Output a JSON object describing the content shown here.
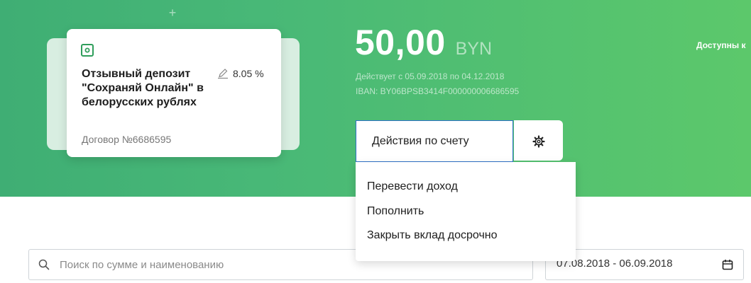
{
  "deposit_card": {
    "title": "Отзывный депозит \"Сохраняй Онлайн\" в белорусских рублях",
    "rate": "8.05 %",
    "contract": "Договор №6686595",
    "icon": "safe-icon"
  },
  "account": {
    "balance": "50,00",
    "currency": "BYN",
    "validity": "Действует с 05.09.2018 по 04.12.2018",
    "iban": "IBAN: BY06BPSB3414F000000006686595",
    "available_label": "Доступны к"
  },
  "actions": {
    "button_label": "Действия по счету",
    "settings_icon": "gear-icon",
    "menu": [
      {
        "label": "Перевести доход"
      },
      {
        "label": "Пополнить"
      },
      {
        "label": "Закрыть вклад досрочно"
      }
    ]
  },
  "filters": {
    "search_placeholder": "Поиск по сумме и наименованию",
    "date_range": "07.08.2018 - 06.09.2018"
  },
  "colors": {
    "header_green": "#48b877",
    "focus_border": "#2f72c8",
    "card_icon": "#2f9e5b"
  }
}
